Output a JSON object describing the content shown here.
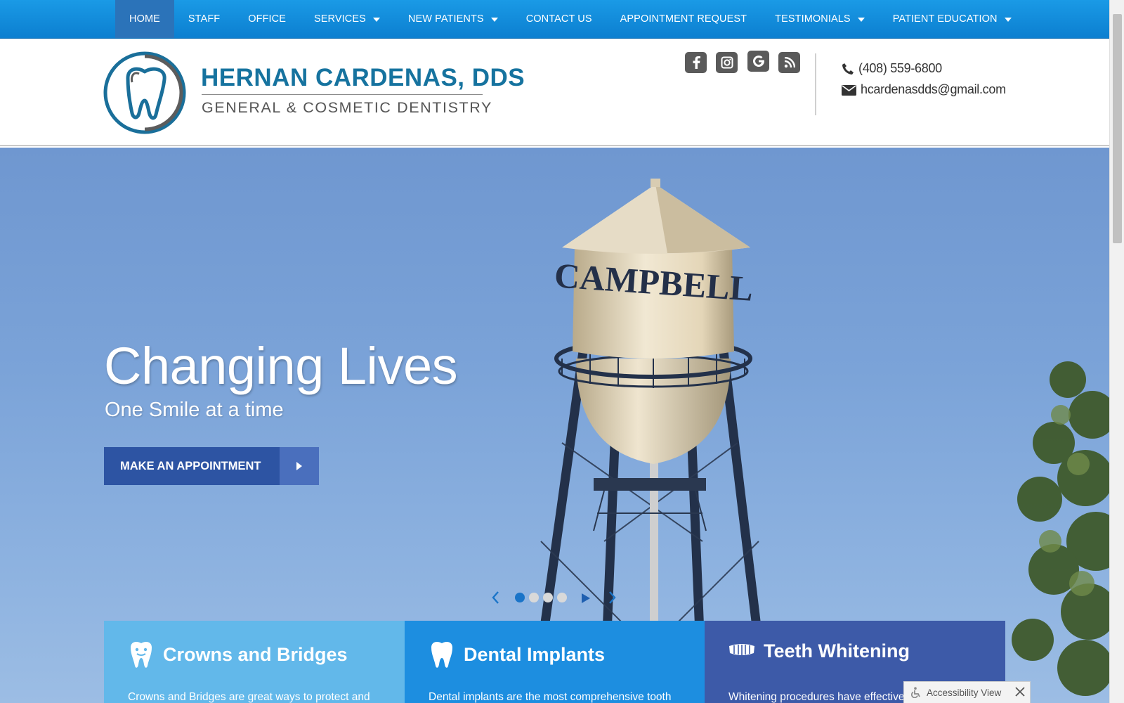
{
  "nav": {
    "items": [
      {
        "label": "HOME",
        "active": true,
        "dropdown": false
      },
      {
        "label": "STAFF",
        "active": false,
        "dropdown": false
      },
      {
        "label": "OFFICE",
        "active": false,
        "dropdown": false
      },
      {
        "label": "SERVICES",
        "active": false,
        "dropdown": true
      },
      {
        "label": "NEW PATIENTS",
        "active": false,
        "dropdown": true
      },
      {
        "label": "CONTACT US",
        "active": false,
        "dropdown": false
      },
      {
        "label": "APPOINTMENT REQUEST",
        "active": false,
        "dropdown": false
      },
      {
        "label": "TESTIMONIALS",
        "active": false,
        "dropdown": true
      },
      {
        "label": "PATIENT EDUCATION",
        "active": false,
        "dropdown": true
      }
    ]
  },
  "header": {
    "logo_title": "HERNAN CARDENAS, DDS",
    "logo_subtitle": "GENERAL & COSMETIC DENTISTRY",
    "social": [
      "facebook-icon",
      "instagram-icon",
      "google-icon",
      "rss-icon"
    ],
    "phone": "(408) 559-6800",
    "email": "hcardenasdds@gmail.com"
  },
  "hero": {
    "title": "Changing Lives",
    "subtitle": "One Smile at a time",
    "cta_label": "MAKE AN APPOINTMENT",
    "tower_text": "CAMPBELL",
    "slides": 4,
    "active_slide": 1
  },
  "cards": [
    {
      "title": "Crowns and Bridges",
      "text": "Crowns and Bridges are great ways to protect and",
      "color": "#62b8ea",
      "icon": "tooth-icon"
    },
    {
      "title": "Dental Implants",
      "text": "Dental implants are the most comprehensive tooth",
      "color": "#1d8ee0",
      "icon": "implant-icon"
    },
    {
      "title": "Teeth Whitening",
      "text": "Whitening procedures have effectively restored the",
      "color": "#3d5aa8",
      "icon": "teeth-row-icon"
    }
  ],
  "accessibility": {
    "label": "Accessibility View"
  },
  "colors": {
    "nav": "#1a9ae6",
    "nav_active": "#2b73b9",
    "brand": "#16739f",
    "cta": "#2d54a3"
  }
}
